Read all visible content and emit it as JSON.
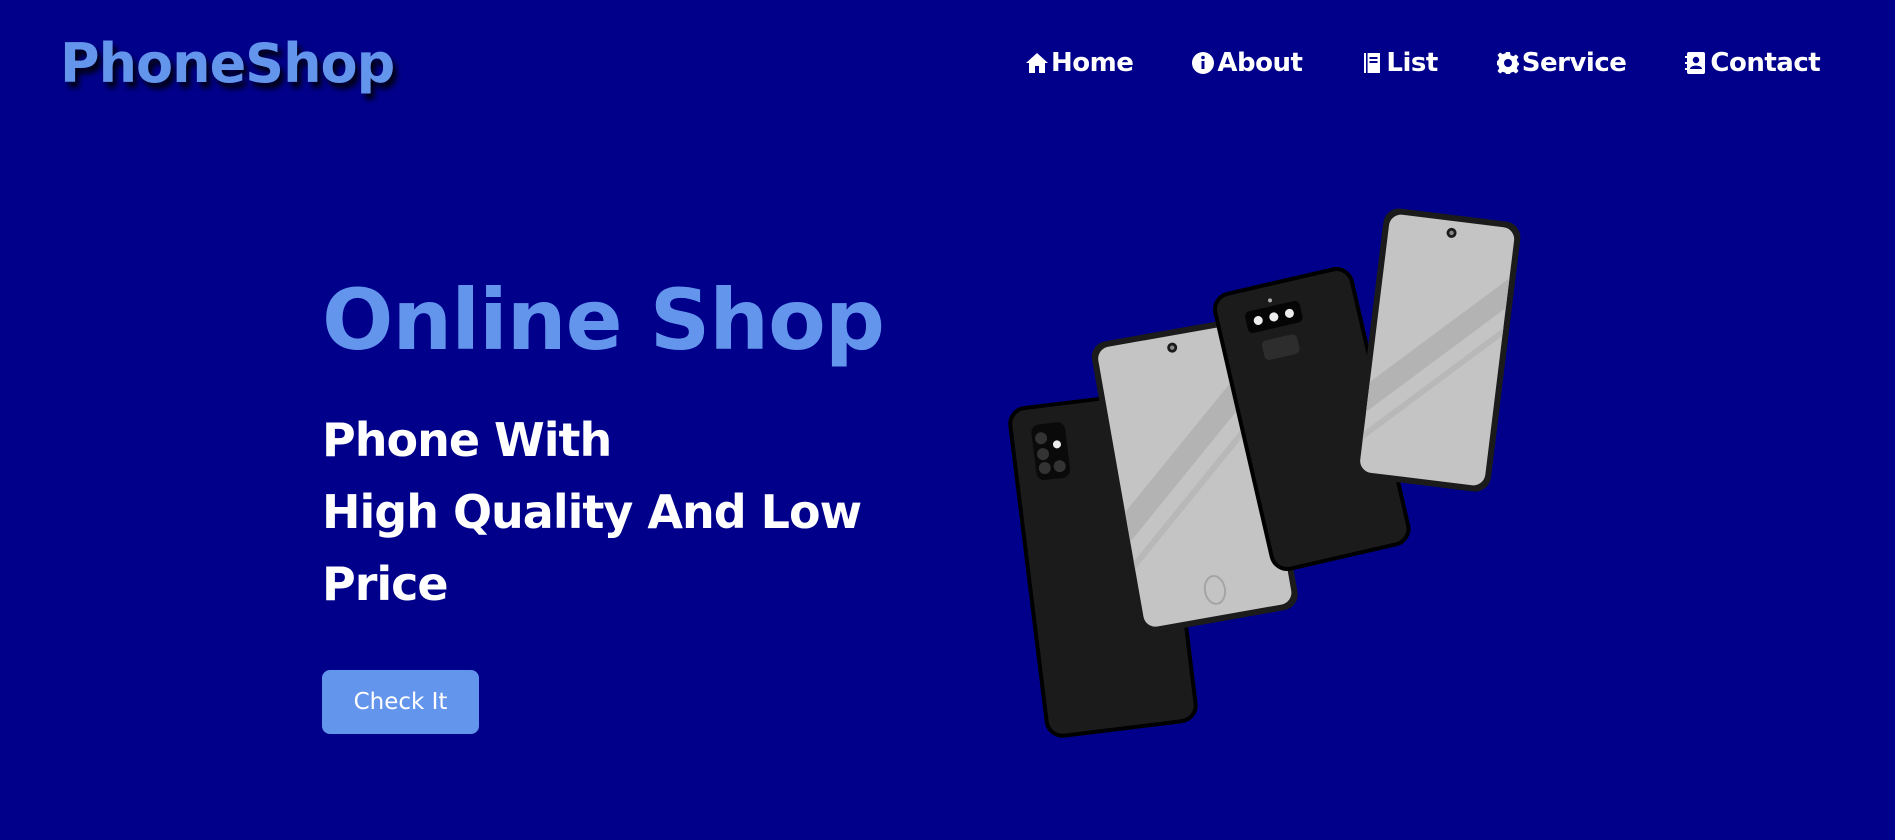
{
  "brand": {
    "name": "PhoneShop",
    "color": "#6495ed"
  },
  "nav": {
    "items": [
      {
        "label": "Home",
        "icon": "home-icon"
      },
      {
        "label": "About",
        "icon": "info-icon"
      },
      {
        "label": "List",
        "icon": "book-icon"
      },
      {
        "label": "Service",
        "icon": "gear-icon"
      },
      {
        "label": "Contact",
        "icon": "address-book-icon"
      }
    ]
  },
  "hero": {
    "title": "Online Shop",
    "subtitle_lines": [
      "Phone With",
      "High Quality And Low",
      "Price"
    ],
    "cta_label": "Check It"
  },
  "colors": {
    "background": "#00008b",
    "accent": "#6495ed",
    "text": "#ffffff"
  },
  "illustration": {
    "icon": "smartphones-illustration"
  }
}
